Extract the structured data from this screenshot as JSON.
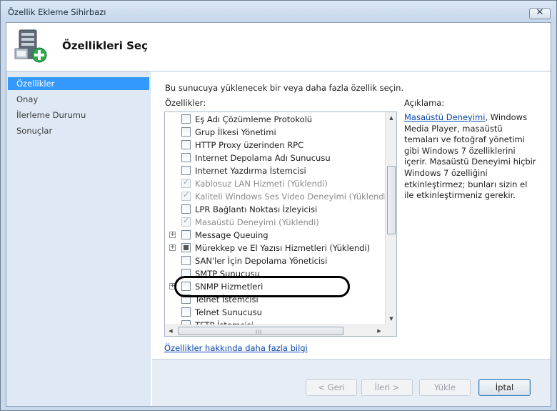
{
  "window": {
    "title": "Özellik Ekleme Sihirbazı",
    "close_glyph": "✕"
  },
  "header": {
    "title": "Özellikleri Seç",
    "icon": "server-add-icon"
  },
  "nav": {
    "items": [
      {
        "label": "Özellikler",
        "active": true
      },
      {
        "label": "Onay",
        "active": false
      },
      {
        "label": "İlerleme Durumu",
        "active": false
      },
      {
        "label": "Sonuçlar",
        "active": false
      }
    ]
  },
  "main": {
    "instruction": "Bu sunucuya yüklenecek bir veya daha fazla özellik seçin.",
    "features_label": "Özellikler:",
    "description_label": "Açıklama:",
    "features": [
      {
        "label": "Eş Adı Çözümleme Protokolü",
        "state": "unchecked",
        "expander": false,
        "disabled": false
      },
      {
        "label": "Grup İlkesi Yönetimi",
        "state": "unchecked",
        "expander": false,
        "disabled": false
      },
      {
        "label": "HTTP Proxy üzerinden RPC",
        "state": "unchecked",
        "expander": false,
        "disabled": false
      },
      {
        "label": "Internet Depolama Adı Sunucusu",
        "state": "unchecked",
        "expander": false,
        "disabled": false
      },
      {
        "label": "Internet Yazdırma İstemcisi",
        "state": "unchecked",
        "expander": false,
        "disabled": false
      },
      {
        "label": "Kablosuz LAN Hizmeti (Yüklendi)",
        "state": "checked",
        "expander": false,
        "disabled": true
      },
      {
        "label": "Kaliteli Windows Ses Video Deneyimi (Yüklendi)",
        "state": "checked",
        "expander": false,
        "disabled": true
      },
      {
        "label": "LPR Bağlantı Noktası İzleyicisi",
        "state": "unchecked",
        "expander": false,
        "disabled": false
      },
      {
        "label": "Masaüstü Deneyimi (Yüklendi)",
        "state": "checked",
        "expander": false,
        "disabled": true
      },
      {
        "label": "Message Queuing",
        "state": "unchecked",
        "expander": true,
        "disabled": false
      },
      {
        "label": "Mürekkep ve El Yazısı Hizmetleri (Yüklendi)",
        "state": "partial",
        "expander": true,
        "disabled": false
      },
      {
        "label": "SAN'ler İçin Depolama Yöneticisi",
        "state": "unchecked",
        "expander": false,
        "disabled": false
      },
      {
        "label": "SMTP Sunucusu",
        "state": "unchecked",
        "expander": false,
        "disabled": false
      },
      {
        "label": "SNMP Hizmetleri",
        "state": "unchecked",
        "expander": true,
        "disabled": false
      },
      {
        "label": "Telnet İstemcisi",
        "state": "unchecked",
        "expander": false,
        "disabled": false
      },
      {
        "label": "Telnet Sunucusu",
        "state": "unchecked",
        "expander": false,
        "disabled": false
      },
      {
        "label": "TFTP İstemcisi",
        "state": "unchecked",
        "expander": false,
        "disabled": false
      }
    ],
    "description_link": "Masaüstü Deneyimi",
    "description_text": ", Windows Media Player, masaüstü temaları ve fotoğraf yönetimi gibi Windows 7 özelliklerini içerir. Masaüstü Deneyimi hiçbir Windows 7 özelliğini etkinleştirmez; bunları sizin el ile etkinleştirmeniz gerekir.",
    "more_info_link": "Özellikler hakkında daha fazla bilgi"
  },
  "buttons": {
    "back": "< Geri",
    "next": "İleri >",
    "install": "Yükle",
    "cancel": "İptal"
  }
}
